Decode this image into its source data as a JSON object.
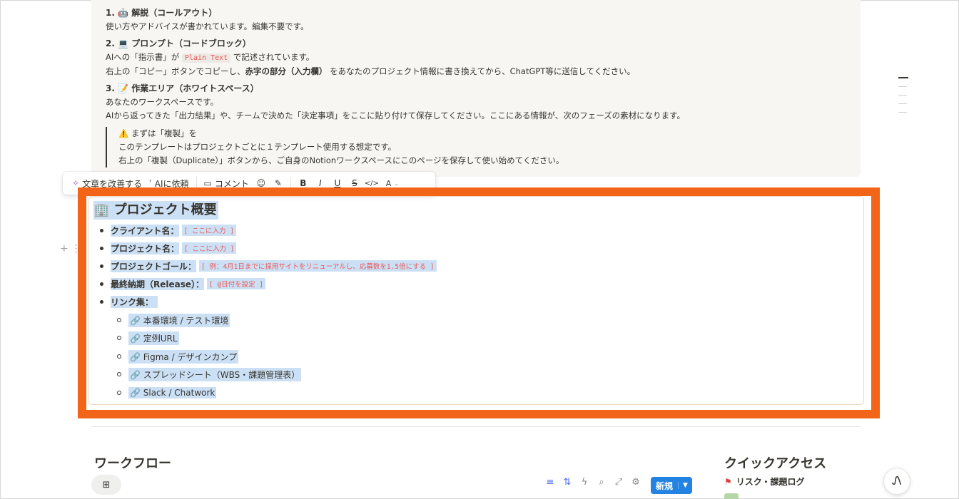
{
  "callout": {
    "s1_heading": "1. 🤖 解説（コールアウト）",
    "s1_line": "使い方やアドバイスが書かれています。編集不要です。",
    "s2_heading": "2. 💻 プロンプト（コードブロック）",
    "s2_l1_a": "AIへの「指示書」が",
    "s2_l1_code": "Plain Text",
    "s2_l1_b": "で記述されています。",
    "s2_l2_a": "右上の「コピー」ボタンでコピーし、",
    "s2_l2_bold": "赤字の部分（入力欄）",
    "s2_l2_b": "をあなたのプロジェクト情報に書き換えてから、ChatGPT等に送信してください。",
    "s3_heading": "3. 📝 作業エリア（ホワイトスペース）",
    "s3_l1": "あなたのワークスペースです。",
    "s3_l2": "AIから返ってきた「出力結果」や、チームで決めた「決定事項」をここに貼り付けて保存してください。ここにある情報が、次のフェーズの素材になります。",
    "quote_l1": "⚠️ まずは「複製」を",
    "quote_l2": "このテンプレートはプロジェクトごとに１テンプレート使用する想定です。",
    "quote_l3": "右上の「複製（Duplicate）」ボタンから、ご自身のNotionワークスペースにこのページを保存して使い始めてください。"
  },
  "toolbar": {
    "improve": "文章を改善する",
    "ask_ai": "AIに依頼",
    "comment": "コメント",
    "bold": "B",
    "italic": "I",
    "underline": "U",
    "strike": "S",
    "code": "</>",
    "color": "A"
  },
  "overview": {
    "title": "🏢 プロジェクト概要",
    "items": [
      {
        "label": "クライアント名：",
        "value": "[ ここに入力 ]"
      },
      {
        "label": "プロジェクト名：",
        "value": "[ ここに入力 ]"
      },
      {
        "label": "プロジェクトゴール：",
        "value": "[ 例：4月1日までに採用サイトをリニューアルし、応募数を1.5倍にする ]"
      },
      {
        "label": "最終納期（Release）：",
        "value": "[ @日付を設定 ]"
      },
      {
        "label": "リンク集：",
        "value": ""
      }
    ],
    "links": [
      "🔗 本番環境 / テスト環境",
      "🔗 定例URL",
      "🔗 Figma / デザインカンプ",
      "🔗 スプレッドシート（WBS・課題管理表）",
      "🔗 Slack / Chatwork"
    ]
  },
  "workflow": {
    "title": "ワークフロー",
    "new_label": "新規"
  },
  "quick_access": {
    "title": "クイックアクセス",
    "item1": "リスク・課題ログ"
  },
  "colors": {
    "highlight_frame": "#f26418",
    "selection": "#cce0f5",
    "red_text": "#eb5757",
    "primary_button": "#2383e2"
  }
}
